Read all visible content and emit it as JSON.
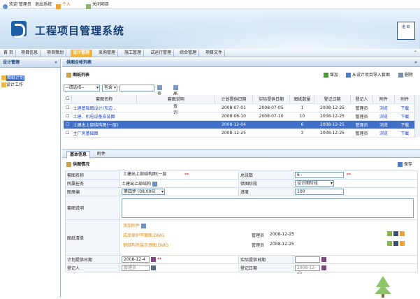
{
  "topbar": {
    "welcome": "欢迎 管理员",
    "logout": "退出系统",
    "personal": "个人",
    "minimize": "关闭项目"
  },
  "header": {
    "title": "工程项目管理系统",
    "corner_logo": "金 软"
  },
  "nav": {
    "items": [
      "首 页",
      "项目信息",
      "项目策划",
      "设计管理",
      "采购管理",
      "施工管理",
      "试运行管理",
      "综合管理",
      "项目文件"
    ],
    "active": "设计管理"
  },
  "sidebar": {
    "title": "设计管理",
    "items": [
      "图纸计划",
      "设计工作"
    ],
    "selected": "图纸计划"
  },
  "main": {
    "panel_title": "供图合帐列表",
    "toolbar": {
      "section": "图纸列表",
      "add": "增加",
      "import": "从设计项目导入套图",
      "delete": "删除"
    },
    "filter": {
      "select1": "--请选择--",
      "select2": "包含",
      "query": "查询",
      "advanced": "高级查询"
    },
    "table": {
      "headers": [
        "套图名称",
        "套图说明",
        "计划提供日期",
        "实际提供日期",
        "图纸数量",
        "登记日期",
        "登记人",
        "附件",
        "附件"
      ],
      "rows": [
        [
          "土建基础图设计(东边...",
          "",
          "2008-07-01",
          "2008-07-05",
          "1",
          "2008-12-25",
          "管理员",
          "浏览",
          "下载"
        ],
        [
          "土建、机电设备安装图",
          "",
          "2008-08-10",
          "2008-07-10",
          "10",
          "2008-12-25",
          "管理员",
          "浏览",
          "下载"
        ],
        [
          "土建出上部结构图(一层)",
          "",
          "2008-12-04",
          "",
          "6",
          "2008-12-25",
          "管理员",
          "浏览",
          "下载"
        ],
        [
          "主厂房基础图",
          "",
          "2008-12-25",
          "",
          "3",
          "2008-12-25",
          "管理员",
          "浏览",
          "下载"
        ]
      ],
      "highlight_row": 2
    },
    "tabs": [
      "基本信息",
      "附件"
    ],
    "section_title": "供图情况",
    "save": "保存",
    "form": {
      "name_label": "套图名称",
      "name_value": "土建出上部结构图(一层",
      "total_label": "总张数",
      "total_value": "6",
      "task_label": "所属任务",
      "task_value": "土建出上部结构",
      "type_label": "供图阶段",
      "type_value": "设计图阶段",
      "drawings_label": "图册编",
      "drawings_value": "第四步 (08.006)",
      "progress_label": "进度",
      "progress_value": "100",
      "desc_label": "套图说明",
      "list_label": "图纸清单",
      "attach_add": "添加附件",
      "files": [
        {
          "name": "成品保护平面图.DWG",
          "person": "管理员",
          "date": "2008-12-25"
        },
        {
          "name": "钢结构吊装示意图.DWG",
          "person": "管理员",
          "date": "2008-12-25"
        }
      ],
      "plan_label": "计划提供日期",
      "plan_value": "2008-12-4",
      "actual_label": "实际提供日期",
      "reg_label": "登记人",
      "reg_value": "管理员",
      "regdate_label": "登记日期",
      "regdate_value": "2008-12-25"
    }
  }
}
